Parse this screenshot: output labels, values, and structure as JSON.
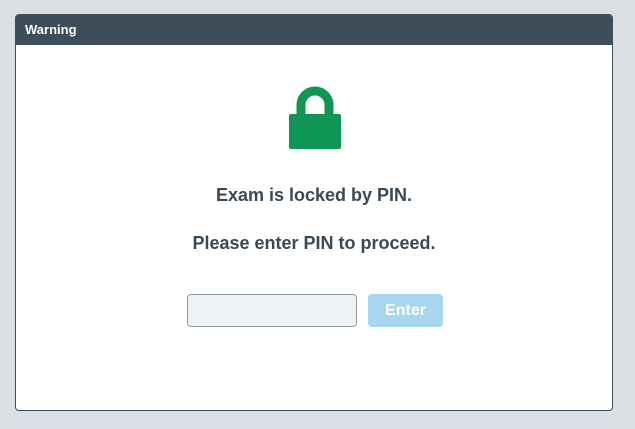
{
  "dialog": {
    "title": "Warning",
    "icon": "lock-icon",
    "icon_color": "#0f9654",
    "message_line1": "Exam is locked by PIN.",
    "message_line2": "Please enter PIN to proceed.",
    "pin_input": {
      "value": "",
      "placeholder": ""
    },
    "enter_label": "Enter"
  },
  "colors": {
    "titlebar": "#3d4e5a",
    "text": "#3b4954",
    "button": "#a7d6ef",
    "background": "#dcdfe1"
  }
}
